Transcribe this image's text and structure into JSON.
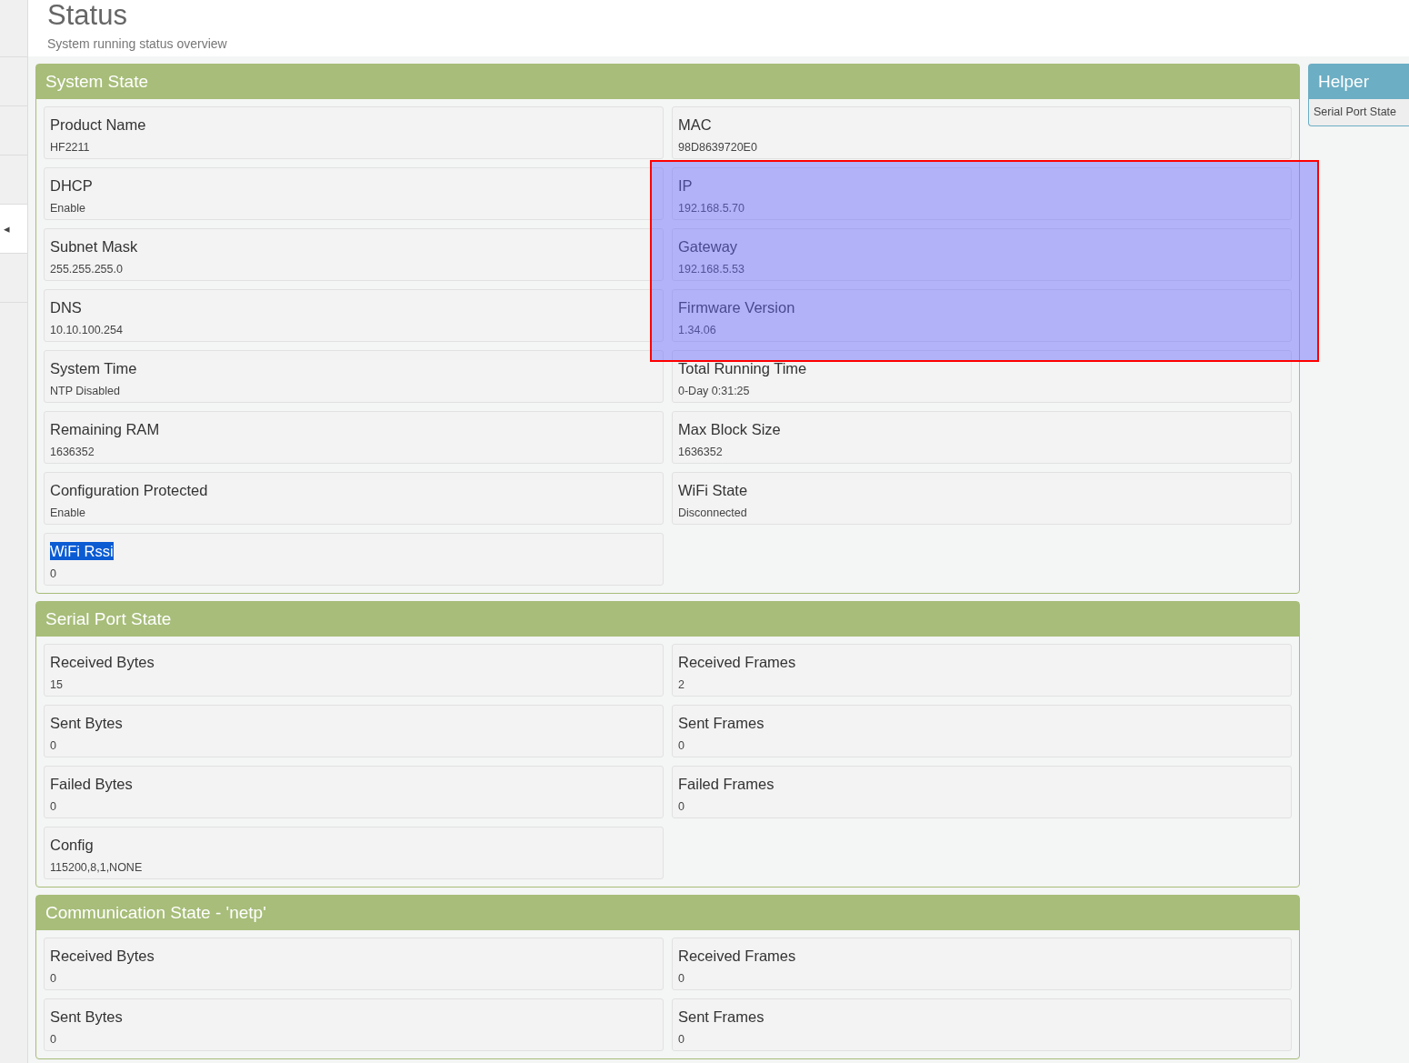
{
  "sidebar": {
    "collapse_icon": "◂"
  },
  "header": {
    "title": "Status",
    "subtitle": "System running status overview"
  },
  "panels": [
    {
      "title": "System State",
      "items": [
        {
          "label": "Product Name",
          "value": "HF2211",
          "highlighted": false,
          "text_selected": false
        },
        {
          "label": "MAC",
          "value": "98D8639720E0",
          "highlighted": false,
          "text_selected": false
        },
        {
          "label": "DHCP",
          "value": "Enable",
          "highlighted": false,
          "text_selected": false
        },
        {
          "label": "IP",
          "value": "192.168.5.70",
          "highlighted": true,
          "text_selected": false
        },
        {
          "label": "Subnet Mask",
          "value": "255.255.255.0",
          "highlighted": false,
          "text_selected": false
        },
        {
          "label": "Gateway",
          "value": "192.168.5.53",
          "highlighted": true,
          "text_selected": false
        },
        {
          "label": "DNS",
          "value": "10.10.100.254",
          "highlighted": false,
          "text_selected": false
        },
        {
          "label": "Firmware Version",
          "value": "1.34.06",
          "highlighted": true,
          "text_selected": false
        },
        {
          "label": "System Time",
          "value": "NTP Disabled",
          "highlighted": false,
          "text_selected": false
        },
        {
          "label": "Total Running Time",
          "value": "0-Day 0:31:25",
          "highlighted": false,
          "text_selected": false
        },
        {
          "label": "Remaining RAM",
          "value": "1636352",
          "highlighted": false,
          "text_selected": false
        },
        {
          "label": "Max Block Size",
          "value": "1636352",
          "highlighted": false,
          "text_selected": false
        },
        {
          "label": "Configuration Protected",
          "value": "Enable",
          "highlighted": false,
          "text_selected": false
        },
        {
          "label": "WiFi State",
          "value": "Disconnected",
          "highlighted": false,
          "text_selected": false
        },
        {
          "label": "WiFi Rssi",
          "value": "0",
          "highlighted": false,
          "text_selected": true
        }
      ]
    },
    {
      "title": "Serial Port State",
      "items": [
        {
          "label": "Received Bytes",
          "value": "15",
          "highlighted": false,
          "text_selected": false
        },
        {
          "label": "Received Frames",
          "value": "2",
          "highlighted": false,
          "text_selected": false
        },
        {
          "label": "Sent Bytes",
          "value": "0",
          "highlighted": false,
          "text_selected": false
        },
        {
          "label": "Sent Frames",
          "value": "0",
          "highlighted": false,
          "text_selected": false
        },
        {
          "label": "Failed Bytes",
          "value": "0",
          "highlighted": false,
          "text_selected": false
        },
        {
          "label": "Failed Frames",
          "value": "0",
          "highlighted": false,
          "text_selected": false
        },
        {
          "label": "Config",
          "value": "115200,8,1,NONE",
          "highlighted": false,
          "text_selected": false
        }
      ]
    },
    {
      "title": "Communication State - 'netp'",
      "items": [
        {
          "label": "Received Bytes",
          "value": "0",
          "highlighted": false,
          "text_selected": false
        },
        {
          "label": "Received Frames",
          "value": "0",
          "highlighted": false,
          "text_selected": false
        },
        {
          "label": "Sent Bytes",
          "value": "0",
          "highlighted": false,
          "text_selected": false
        },
        {
          "label": "Sent Frames",
          "value": "0",
          "highlighted": false,
          "text_selected": false
        }
      ]
    }
  ],
  "helper": {
    "title": "Helper",
    "items": [
      "Serial Port State"
    ]
  }
}
